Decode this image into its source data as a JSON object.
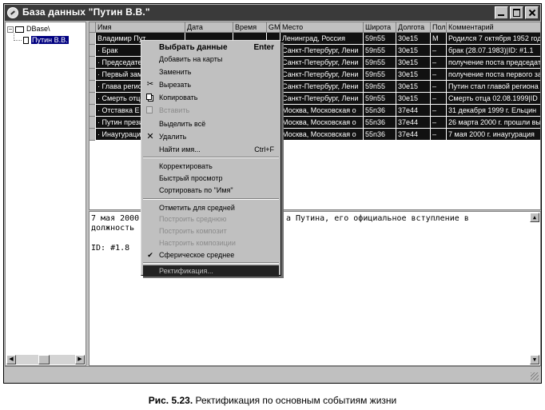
{
  "window": {
    "title": "База данных \"Путин В.В.\""
  },
  "tree": {
    "root_label": "DBase\\",
    "expander": "−",
    "child_label": "Путин В.В."
  },
  "grid": {
    "columns": [
      "Имя",
      "Дата",
      "Время",
      "GM",
      "Место",
      "Широта",
      "Долгота",
      "Пол",
      "Комментарий"
    ],
    "rows": [
      [
        "Владимир Пут",
        "",
        "",
        "",
        "Ленинград, Россия",
        "59n55",
        "30e15",
        "М",
        "Родился 7 октября 1952 года"
      ],
      [
        "· Брак",
        "",
        "",
        "",
        "Санкт-Петербург, Лени",
        "59n55",
        "30e15",
        "–",
        "брак (28.07.1983)|ID: #1.1"
      ],
      [
        "· Председател",
        "",
        "",
        "",
        "Санкт-Петербург, Лени",
        "59n55",
        "30e15",
        "–",
        "получение поста председател"
      ],
      [
        "· Первый зам",
        "",
        "",
        "",
        "Санкт-Петербург, Лени",
        "59n55",
        "30e15",
        "–",
        "получение поста первого зам"
      ],
      [
        "· Глава регион",
        "",
        "",
        "",
        "Санкт-Петербург, Лени",
        "59n55",
        "30e15",
        "–",
        "Путин стал главой региона"
      ],
      [
        "· Смерть отца",
        "",
        "",
        "",
        "Санкт-Петербург, Лени",
        "59n55",
        "30e15",
        "–",
        "Смерть отца 02.08.1999|ID"
      ],
      [
        "· Отставка Е",
        "",
        "",
        "",
        "Москва, Московская о",
        "55n36",
        "37e44",
        "–",
        "31 декабря 1999 г. Ельцин"
      ],
      [
        "· Путин прези",
        "",
        "",
        "",
        "Москва, Московская о",
        "55n36",
        "37e44",
        "–",
        "26 марта 2000 г. прошли вы"
      ],
      [
        "· Инаугурация",
        "",
        "",
        "",
        "Москва, Московская о",
        "55n36",
        "37e44",
        "–",
        "7 мая 2000 г. инаугурация"
      ]
    ]
  },
  "memo": {
    "line1_left": "7 мая 2000",
    "line1_right": "а Путина, его официальное вступление в",
    "line2": "должность",
    "line3": "ID: #1.8"
  },
  "context_menu": {
    "items": [
      {
        "label": "Выбрать данные",
        "shortcut": "Enter"
      },
      {
        "label": "Добавить на карты"
      },
      {
        "label": "Заменить"
      },
      {
        "label": "Вырезать"
      },
      {
        "label": "Копировать"
      },
      {
        "label": "Вставить"
      },
      {
        "label": "Выделить всё"
      },
      {
        "label": "Удалить"
      },
      {
        "label": "Найти имя...",
        "shortcut": "Ctrl+F"
      },
      {
        "label": "Корректировать"
      },
      {
        "label": "Быстрый просмотр"
      },
      {
        "label": "Сортировать по \"Имя\""
      },
      {
        "label": "Отметить для средней"
      },
      {
        "label": "Построить среднюю"
      },
      {
        "label": "Построить композит"
      },
      {
        "label": "Настроить композиции"
      },
      {
        "label": "Сферическое среднее"
      },
      {
        "label": "Ректификация..."
      }
    ]
  },
  "caption": {
    "prefix": "Рис. 5.23.",
    "text": " Ректификация по основным событиям жизни"
  }
}
